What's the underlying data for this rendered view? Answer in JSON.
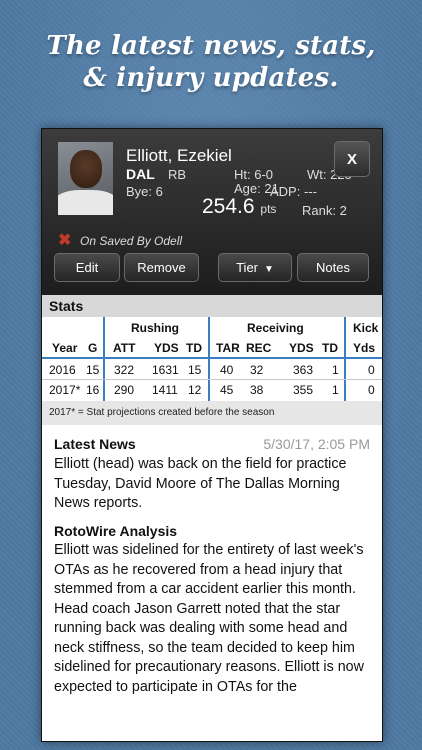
{
  "headline": {
    "line1": "The latest news, stats,",
    "line2": "& injury updates."
  },
  "player": {
    "name": "Elliott, Ezekiel",
    "team": "DAL",
    "position": "RB",
    "bye": "Bye: 6",
    "height": "Ht: 6-0",
    "weight": "Wt: 225",
    "age": "Age: 21",
    "adp": "ADP: ---",
    "points": "254.6",
    "points_unit": "pts",
    "rank": "Rank: 2",
    "close_label": "X"
  },
  "saved": {
    "icon": "x-mark-icon",
    "text": "On Saved By Odell"
  },
  "actions": {
    "edit": "Edit",
    "remove": "Remove",
    "tier": "Tier",
    "notes": "Notes"
  },
  "stats": {
    "title": "Stats",
    "groups": {
      "rushing": "Rushing",
      "receiving": "Receiving",
      "kick": "Kick"
    },
    "headers": [
      "Year",
      "G",
      "ATT",
      "YDS",
      "TD",
      "TAR",
      "REC",
      "YDS",
      "TD",
      "Yds"
    ],
    "rows": [
      [
        "2016",
        "15",
        "322",
        "1631",
        "15",
        "40",
        "32",
        "363",
        "1",
        "0"
      ],
      [
        "2017*",
        "16",
        "290",
        "1411",
        "12",
        "45",
        "38",
        "355",
        "1",
        "0"
      ]
    ],
    "footnote": "2017* = Stat projections created before the season"
  },
  "news": {
    "heading": "Latest News",
    "date": "5/30/17, 2:05 PM",
    "text": "Elliott (head) was back on the field for practice Tuesday, David Moore of The Dallas Morning News reports.",
    "analysis_heading": "RotoWire Analysis",
    "analysis": "Elliott was sidelined for the entirety of last week's OTAs as he recovered from a head injury that stemmed from a car accident earlier this month. Head coach Jason Garrett noted that the star running back was dealing with some head and neck stiffness, so the team decided to keep him sidelined for precautionary reasons. Elliott is now expected to participate in OTAs for the"
  },
  "colors": {
    "background": "#4f7aa3",
    "grid_accent": "#3a7dc0",
    "saved_icon": "#c0392b"
  }
}
